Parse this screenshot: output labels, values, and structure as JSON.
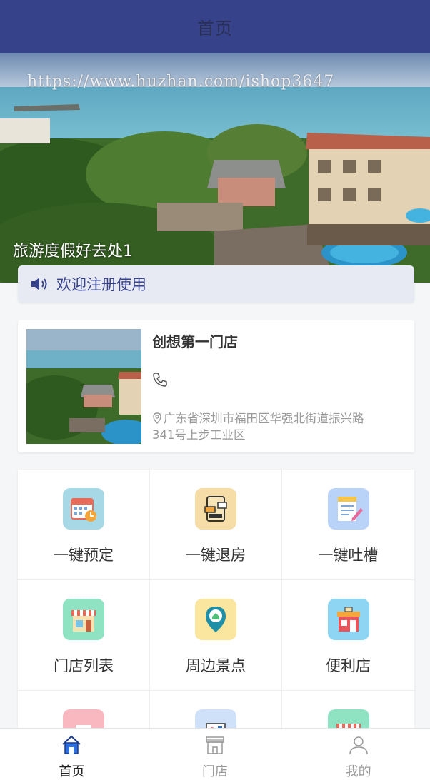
{
  "header": {
    "title": "首页"
  },
  "banner": {
    "watermark": "https://www.huzhan.com/ishop3647",
    "caption": "旅游度假好去处1"
  },
  "notice": {
    "text": "欢迎注册使用"
  },
  "store": {
    "name": "创想第一门店",
    "address": "广东省深圳市福田区华强北街道振兴路341号上步工业区"
  },
  "grid": {
    "items": [
      {
        "label": "一键预定",
        "icon": "calendar-icon",
        "bg": "#a7d8e6"
      },
      {
        "label": "一键退房",
        "icon": "checkout-icon",
        "bg": "#f6dca6"
      },
      {
        "label": "一键吐槽",
        "icon": "notepad-icon",
        "bg": "#b9d2f7"
      },
      {
        "label": "门店列表",
        "icon": "store-icon",
        "bg": "#8fe3c3"
      },
      {
        "label": "周边景点",
        "icon": "location-icon",
        "bg": "#fbe69f"
      },
      {
        "label": "便利店",
        "icon": "shop-icon",
        "bg": "#8ed5f3"
      },
      {
        "label": "",
        "icon": "building-icon",
        "bg": "#f9b8c0"
      },
      {
        "label": "",
        "icon": "service-icon",
        "bg": "#cfe0f9"
      },
      {
        "label": "",
        "icon": "market-icon",
        "bg": "#8fe3c3"
      }
    ]
  },
  "tabbar": {
    "items": [
      {
        "label": "首页",
        "icon": "home-icon",
        "active": true
      },
      {
        "label": "门店",
        "icon": "storefront-icon",
        "active": false
      },
      {
        "label": "我的",
        "icon": "user-icon",
        "active": false
      }
    ]
  },
  "colors": {
    "primary": "#36428a",
    "accent": "#2f6fe0"
  }
}
